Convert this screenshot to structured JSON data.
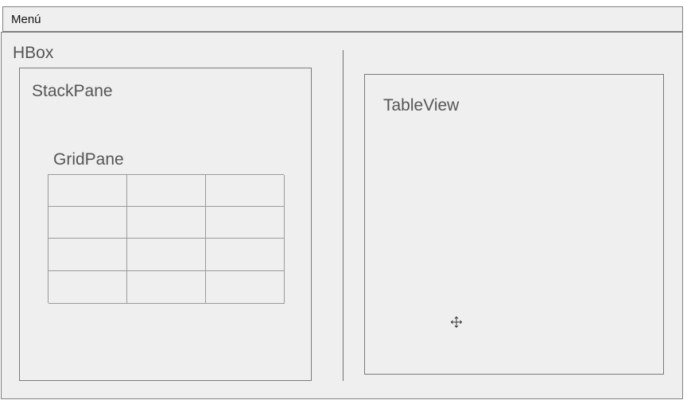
{
  "menu": {
    "label": "Menú"
  },
  "hbox": {
    "label": "HBox"
  },
  "stackpane": {
    "label": "StackPane"
  },
  "gridpane": {
    "label": "GridPane",
    "rows": 4,
    "columns": 3
  },
  "tableview": {
    "label": "TableView"
  },
  "icons": {
    "cursor": "move-cursor-icon"
  },
  "colors": {
    "background": "#efefef",
    "border": "#808080",
    "label": "#555555"
  }
}
